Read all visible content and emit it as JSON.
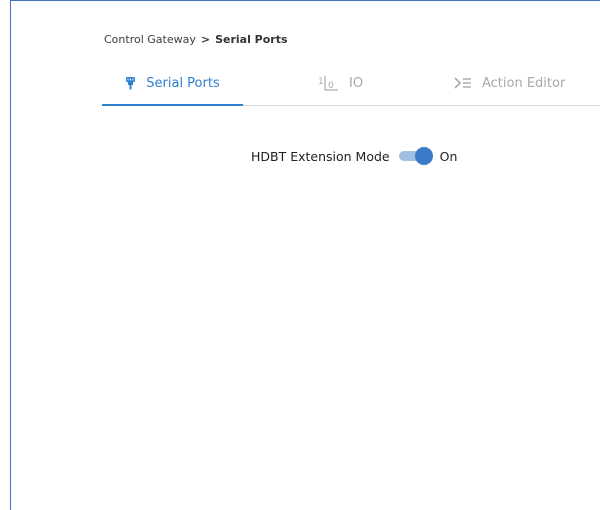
{
  "breadcrumb": {
    "parent": "Control Gateway",
    "separator": ">",
    "current": "Serial Ports"
  },
  "tabs": [
    {
      "label": "Serial Ports",
      "icon": "serial-port-icon",
      "active": true
    },
    {
      "label": "IO",
      "icon": "io-icon",
      "active": false
    },
    {
      "label": "Action Editor",
      "icon": "action-editor-icon",
      "active": false
    }
  ],
  "hdbt": {
    "label": "HDBT Extension Mode",
    "state": "On",
    "enabled": true
  },
  "colors": {
    "accent": "#2f7fcf",
    "inactive_tab": "#a8a8a8",
    "frame_border": "#4472c4",
    "switch_track": "#9fc0e3",
    "switch_knob": "#3a7ac7"
  }
}
